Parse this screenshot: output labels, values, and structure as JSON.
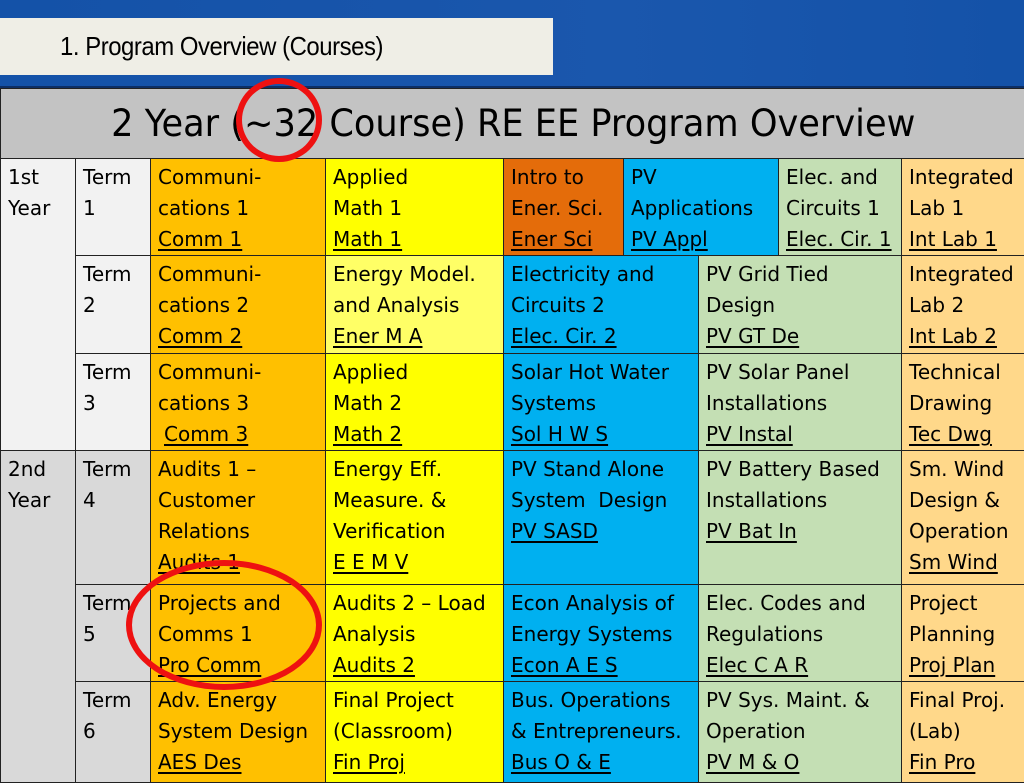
{
  "slide": {
    "title": "1. Program Overview (Courses)",
    "table_title": "2 Year (~32 Course) RE EE Program Overview"
  },
  "colors": {
    "background_blue": "#1855ab",
    "header_gray": "#c3c3c3",
    "year1_gray": "#f2f2f2",
    "year2_gray": "#d9d9d9",
    "orange": "#ffc000",
    "yellow": "#ffff00",
    "light_yellow": "#ffff66",
    "dark_orange": "#e46c0a",
    "blue": "#00b0f0",
    "green": "#c4dfb4",
    "tan": "#ffd88a",
    "annotation_red": "#ee1111"
  },
  "years": [
    {
      "line1": "1st",
      "line2": "Year"
    },
    {
      "line1": "2nd",
      "line2": "Year"
    }
  ],
  "terms": [
    {
      "line1": "Term",
      "line2": "1",
      "courses": [
        {
          "name_lines": [
            "Communi-",
            "cations 1"
          ],
          "code": "Comm 1"
        },
        {
          "name_lines": [
            "Applied",
            "Math 1"
          ],
          "code": "Math 1"
        },
        {
          "name_lines": [
            "Intro to",
            "Ener. Sci."
          ],
          "code": "Ener Sci"
        },
        {
          "name_lines": [
            "PV",
            "Applications"
          ],
          "code": "PV Appl"
        },
        {
          "name_lines": [
            "Elec. and",
            "Circuits 1"
          ],
          "code": "Elec. Cir. 1"
        },
        {
          "name_lines": [
            "Integrated",
            "Lab 1"
          ],
          "code": "Int Lab 1"
        }
      ]
    },
    {
      "line1": "Term",
      "line2": "2",
      "courses": [
        {
          "name_lines": [
            "Communi-",
            "cations 2"
          ],
          "code": "Comm 2"
        },
        {
          "name_lines": [
            "Energy Model.",
            "and Analysis"
          ],
          "code": "Ener M A"
        },
        {
          "name_lines": [
            "Electricity and",
            "Circuits 2"
          ],
          "code": "Elec. Cir. 2"
        },
        {
          "name_lines": [
            "PV Grid Tied",
            "Design"
          ],
          "code": "PV GT De"
        },
        {
          "name_lines": [
            "Integrated",
            "Lab 2"
          ],
          "code": "Int Lab 2"
        }
      ]
    },
    {
      "line1": "Term",
      "line2": "3",
      "courses": [
        {
          "name_lines": [
            "Communi-",
            "cations 3"
          ],
          "code": "Comm 3"
        },
        {
          "name_lines": [
            "Applied",
            "Math 2"
          ],
          "code": "Math 2"
        },
        {
          "name_lines": [
            "Solar Hot Water",
            "Systems"
          ],
          "code": "Sol H W S"
        },
        {
          "name_lines": [
            "PV Solar Panel",
            "Installations"
          ],
          "code": "PV Instal"
        },
        {
          "name_lines": [
            "Technical",
            "Drawing"
          ],
          "code": "Tec Dwg"
        }
      ]
    },
    {
      "line1": "Term",
      "line2": "4",
      "courses": [
        {
          "name_lines": [
            "Audits 1 –",
            "Customer",
            "Relations"
          ],
          "code": "Audits 1"
        },
        {
          "name_lines": [
            "Energy Eff.",
            "Measure. &",
            "Verification"
          ],
          "code": "E E M V"
        },
        {
          "name_lines": [
            "PV Stand Alone",
            "System  Design"
          ],
          "code": "PV SASD"
        },
        {
          "name_lines": [
            "PV Battery Based",
            "Installations"
          ],
          "code": "PV Bat In"
        },
        {
          "name_lines": [
            "Sm. Wind",
            "Design &",
            "Operation"
          ],
          "code": "Sm Wind"
        }
      ]
    },
    {
      "line1": "Term",
      "line2": "5",
      "courses": [
        {
          "name_lines": [
            "Projects and",
            "Comms 1"
          ],
          "code": "Pro Comm"
        },
        {
          "name_lines": [
            "Audits 2 – Load",
            "Analysis"
          ],
          "code": "Audits 2"
        },
        {
          "name_lines": [
            "Econ Analysis of",
            "Energy Systems"
          ],
          "code": "Econ A E S"
        },
        {
          "name_lines": [
            "Elec. Codes and",
            "Regulations"
          ],
          "code": "Elec C A R"
        },
        {
          "name_lines": [
            "Project",
            "Planning"
          ],
          "code": "Proj Plan"
        }
      ]
    },
    {
      "line1": "Term",
      "line2": "6",
      "courses": [
        {
          "name_lines": [
            "Adv. Energy",
            "System Design"
          ],
          "code": "AES Des"
        },
        {
          "name_lines": [
            "Final Project",
            "(Classroom)"
          ],
          "code": "Fin Proj"
        },
        {
          "name_lines": [
            "Bus. Operations",
            "& Entrepreneurs."
          ],
          "code": "Bus O & E"
        },
        {
          "name_lines": [
            "PV Sys. Maint. &",
            "Operation"
          ],
          "code": "PV M & O"
        },
        {
          "name_lines": [
            "Final Proj.",
            "(Lab)"
          ],
          "code": "Fin Pro"
        }
      ]
    }
  ],
  "annotations": [
    {
      "type": "red-circle",
      "target": "~32"
    },
    {
      "type": "red-circle",
      "target": "Projects and Comms 1"
    }
  ]
}
